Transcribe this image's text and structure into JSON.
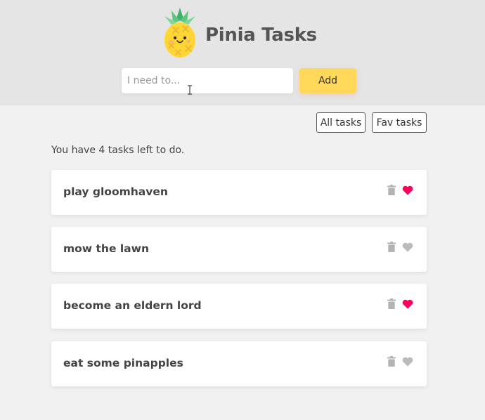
{
  "header": {
    "title": "Pinia Tasks",
    "logo_icon": "pineapple-logo-icon"
  },
  "new_task": {
    "placeholder": "I need to...",
    "value": "",
    "add_label": "Add"
  },
  "filters": {
    "all_label": "All tasks",
    "fav_label": "Fav tasks"
  },
  "summary": {
    "text": "You have 4 tasks left to do."
  },
  "tasks": [
    {
      "title": "play gloomhaven",
      "favorite": true
    },
    {
      "title": "mow the lawn",
      "favorite": false
    },
    {
      "title": "become an eldern lord",
      "favorite": true
    },
    {
      "title": "eat some pinapples",
      "favorite": false
    }
  ],
  "colors": {
    "header_bg": "#e5e5e5",
    "page_bg": "#f1f1f1",
    "add_button": "#ffd859",
    "heart_favorite": "#ff005d",
    "heart_default": "#bbbbbb",
    "trash": "#b3b3b3"
  }
}
